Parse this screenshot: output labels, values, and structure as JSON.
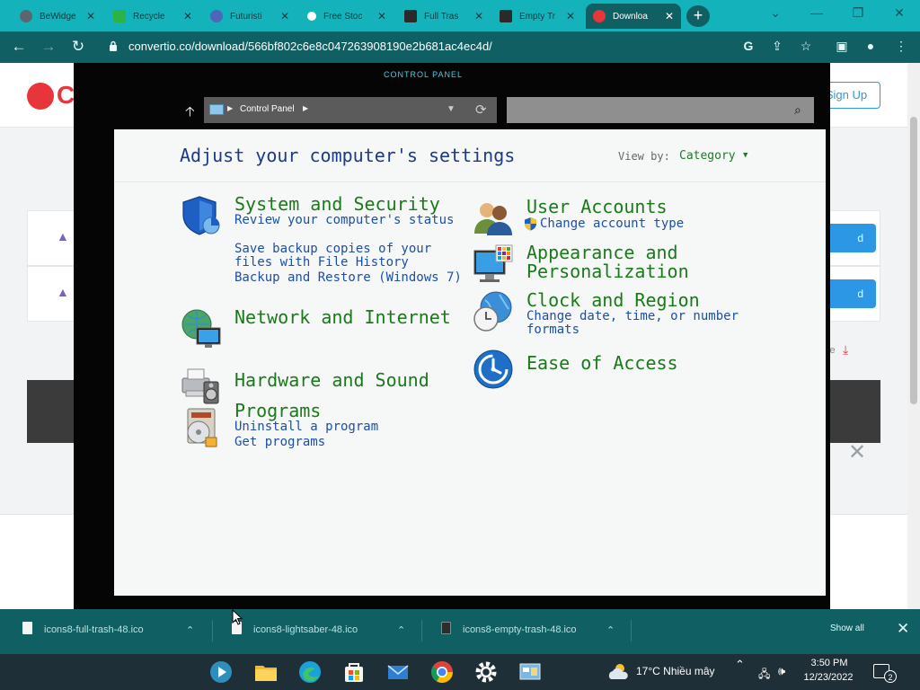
{
  "browser": {
    "tabs": [
      {
        "label": "BeWidge",
        "favicon_color": "#5b6770"
      },
      {
        "label": "Recycle",
        "favicon_color": "#2bb34a"
      },
      {
        "label": "Futuristi",
        "favicon_color": "#4a67b8"
      },
      {
        "label": "Free Stoc",
        "favicon_color": "#ffffff"
      },
      {
        "label": "Full Tras",
        "favicon_color": "#2a2a2a"
      },
      {
        "label": "Empty Tr",
        "favicon_color": "#2a2a2a"
      },
      {
        "label": "Downloa",
        "favicon_color": "#e8353a",
        "active": true
      }
    ],
    "url": "convertio.co/download/566bf802c6e8c047263908190e2b681ac4ec4d/",
    "colors": {
      "frame": "#14b3bb",
      "toolbar": "#0f5f63"
    }
  },
  "site": {
    "logo_letter": "C",
    "signup_label": "Sign Up",
    "download_btn_label": "d",
    "save_text": "ve"
  },
  "control_panel": {
    "window_title": "CONTROL PANEL",
    "address": "Control Panel",
    "heading": "Adjust your computer's settings",
    "view_by_label": "View by:",
    "view_by_value": "Category",
    "categories": {
      "system": {
        "title": "System and Security",
        "links": [
          "Review your computer's status",
          "Save backup copies of your files with File History",
          "Backup and Restore (Windows 7)"
        ]
      },
      "network": {
        "title": "Network and Internet"
      },
      "hardware": {
        "title": "Hardware and Sound"
      },
      "programs": {
        "title": "Programs",
        "links": [
          "Uninstall a program",
          "Get programs"
        ]
      },
      "users": {
        "title": "User Accounts",
        "links": [
          "Change account type"
        ]
      },
      "appearance": {
        "title": "Appearance and Personalization"
      },
      "clock": {
        "title": "Clock and Region",
        "links": [
          "Change date, time, or number formats"
        ]
      },
      "access": {
        "title": "Ease of Access"
      }
    }
  },
  "downloads": {
    "items": [
      "icons8-full-trash-48.ico",
      "icons8-lightsaber-48.ico",
      "icons8-empty-trash-48.ico"
    ],
    "show_all": "Show all"
  },
  "taskbar": {
    "apps": [
      "media-player",
      "file-explorer",
      "edge",
      "store",
      "mail",
      "chrome",
      "settings",
      "control-panel"
    ],
    "weather": "17°C  Nhiều mây",
    "time": "3:50 PM",
    "date": "12/23/2022",
    "notifications": "2"
  }
}
